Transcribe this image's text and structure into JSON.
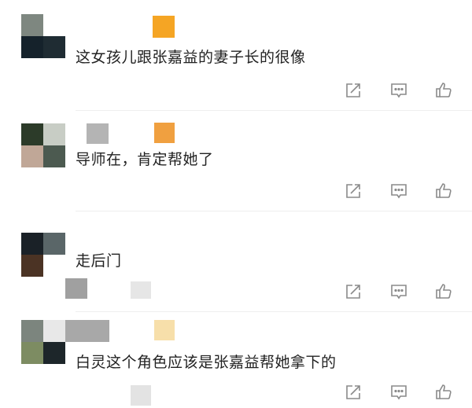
{
  "comments": [
    {
      "text": "这女孩儿跟张嘉益的妻子长的很像",
      "actions": [
        "share-icon",
        "comment-icon",
        "like-icon"
      ]
    },
    {
      "text": "导师在，肯定帮她了",
      "actions": [
        "share-icon",
        "comment-icon",
        "like-icon"
      ]
    },
    {
      "text": "走后门",
      "actions": [
        "share-icon",
        "comment-icon",
        "like-icon"
      ]
    },
    {
      "text": "白灵这个角色应该是张嘉益帮她拿下的",
      "actions": [
        "share-icon",
        "comment-icon",
        "like-icon"
      ]
    }
  ],
  "colors": {
    "orange_badge": "#f5a524",
    "orange_badge_2": "#f0a040",
    "pale_badge": "#f7dfaa",
    "icon_gray": "#8a8a8a"
  }
}
